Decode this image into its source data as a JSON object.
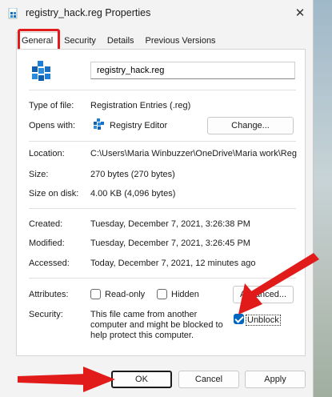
{
  "window": {
    "title": "registry_hack.reg Properties",
    "close_glyph": "✕"
  },
  "tabs": [
    {
      "label": "General",
      "active": true
    },
    {
      "label": "Security",
      "active": false
    },
    {
      "label": "Details",
      "active": false
    },
    {
      "label": "Previous Versions",
      "active": false
    }
  ],
  "general": {
    "file_name": "registry_hack.reg",
    "type_label": "Type of file:",
    "type_value": "Registration Entries (.reg)",
    "opens_label": "Opens with:",
    "opens_value": "Registry Editor",
    "change_button": "Change...",
    "location_label": "Location:",
    "location_value": "C:\\Users\\Maria Winbuzzer\\OneDrive\\Maria work\\Reg fil",
    "size_label": "Size:",
    "size_value": "270 bytes (270 bytes)",
    "size_disk_label": "Size on disk:",
    "size_disk_value": "4.00 KB (4,096 bytes)",
    "created_label": "Created:",
    "created_value": "Tuesday, December 7, 2021, 3:26:38 PM",
    "modified_label": "Modified:",
    "modified_value": "Tuesday, December 7, 2021, 3:26:45 PM",
    "accessed_label": "Accessed:",
    "accessed_value": "Today, December 7, 2021, 12 minutes ago",
    "attributes_label": "Attributes:",
    "readonly_label": "Read-only",
    "readonly_checked": false,
    "hidden_label": "Hidden",
    "hidden_checked": false,
    "advanced_button": "Advanced...",
    "security_label": "Security:",
    "security_text": "This file came from another computer and might be blocked to help protect this computer.",
    "unblock_label": "Unblock",
    "unblock_checked": true
  },
  "footer": {
    "ok": "OK",
    "cancel": "Cancel",
    "apply": "Apply"
  },
  "colors": {
    "highlight": "#e11a1a",
    "accent": "#0067c0"
  }
}
